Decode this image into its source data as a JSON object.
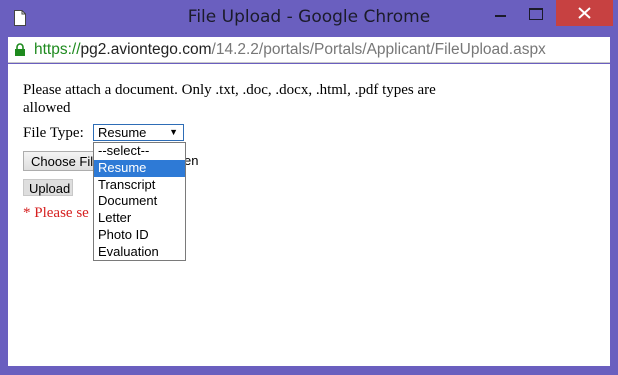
{
  "window": {
    "title": "File Upload - Google Chrome"
  },
  "address_bar": {
    "scheme": "https://",
    "host": "pg2.aviontego.com",
    "path": "/14.2.2/portals/Portals/Applicant/FileUpload.aspx"
  },
  "page": {
    "instruction": "Please attach a document. Only .txt, .doc, .docx, .html, .pdf types are allowed",
    "file_type_label": "File Type:",
    "select_value": "Resume",
    "select_options": [
      "--select--",
      "Resume",
      "Transcript",
      "Document",
      "Letter",
      "Photo ID",
      "Evaluation"
    ],
    "choose_file_label": "Choose File",
    "no_file_label": "en",
    "upload_label": "Upload",
    "error_text": "* Please se"
  },
  "colors": {
    "window_frame": "#6a5fbf",
    "close_button": "#c74141",
    "link_secure": "#1e8a1e",
    "selected_option": "#2e7ad6",
    "error": "#d62020"
  }
}
